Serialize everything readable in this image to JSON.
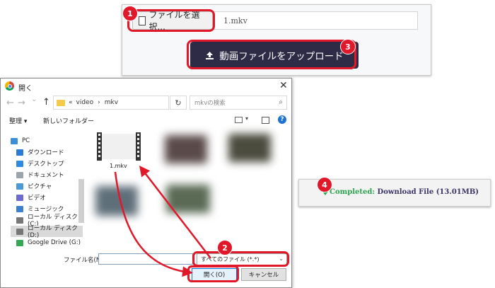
{
  "upload_panel": {
    "file_select_label": "ファイルを選択...",
    "file_name": "1.mkv",
    "upload_label": "動画ファイルをアップロード"
  },
  "steps": [
    "1",
    "2",
    "3",
    "4"
  ],
  "dialog": {
    "title": "開く",
    "close_glyph": "✕",
    "nav_back": "←",
    "nav_forward": "→",
    "nav_recent": "⌄",
    "nav_up": "↑",
    "address": {
      "prefix": "«",
      "path": [
        "video",
        "mkv"
      ],
      "separator": "›"
    },
    "refresh_glyph": "↻",
    "search_placeholder": "mkvの検索",
    "toolbar": {
      "organize": "整理 ▾",
      "new_folder": "新しいフォルダー"
    },
    "nav_items": [
      {
        "label": "PC",
        "color": "#3a8fd8"
      },
      {
        "label": "ダウンロード",
        "color": "#2b7bd6"
      },
      {
        "label": "デスクトップ",
        "color": "#2d8ae0"
      },
      {
        "label": "ドキュメント",
        "color": "#9aa4ad"
      },
      {
        "label": "ピクチャ",
        "color": "#4a9ad8"
      },
      {
        "label": "ビデオ",
        "color": "#6b6bd0"
      },
      {
        "label": "ミュージック",
        "color": "#3b7fd0"
      },
      {
        "label": "ローカル ディスク (C:)",
        "color": "#777777"
      },
      {
        "label": "ローカル ディスク (D:)",
        "color": "#777777"
      },
      {
        "label": "Google Drive (G:)",
        "color": "#34a853"
      }
    ],
    "selected_nav_index": 8,
    "file_label": "1.mkv",
    "filename_label": "ファイル名(N):",
    "filetype_value": "すべてのファイル (*.*)",
    "open_label": "開く(O)",
    "cancel_label": "キャンセル"
  },
  "completed": {
    "status": "Completed:",
    "detail": "Download File (13.01MB)"
  },
  "colors": {
    "highlight": "#e0182a",
    "upload_button": "#2e2b47",
    "success": "#2ea44f"
  }
}
